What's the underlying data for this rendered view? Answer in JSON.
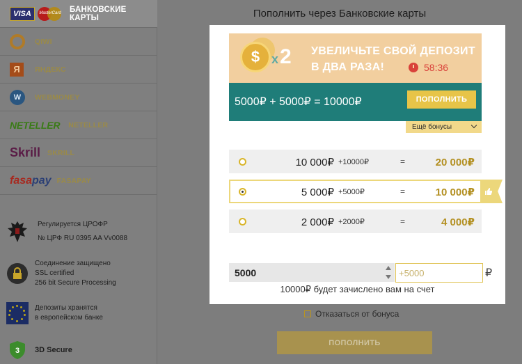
{
  "sidebar": {
    "items": [
      {
        "label": "БАНКОВСКИЕ КАРТЫ",
        "icon": "visa-mastercard-icon",
        "visa_text": "VISA",
        "mc_text": "MasterCard",
        "active": true
      },
      {
        "label": "QIWI",
        "icon": "qiwi-icon"
      },
      {
        "label": "ЯНДЕКС",
        "icon": "yandex-icon",
        "logo_text": "Я"
      },
      {
        "label": "WEBMONEY",
        "icon": "webmoney-icon",
        "logo_text": "W"
      },
      {
        "label": "NETELLER",
        "icon": "neteller-icon",
        "logo_text": "NETELLER"
      },
      {
        "label": "SKRILL",
        "icon": "skrill-icon",
        "logo_text": "Skrill"
      },
      {
        "label": "FASAPAY",
        "icon": "fasapay-icon",
        "logo_text_a": "fasa",
        "logo_text_b": "pay"
      }
    ],
    "info": {
      "regulation_line1": "Регулируется ЦРОФР",
      "regulation_line2": "№ ЦРФ RU 0395 AA Vv0088",
      "secure_line1": "Соединение защищено",
      "secure_line2": "SSL certified",
      "secure_line3": "256 bit Secure Processing",
      "deposit_line1": "Депозиты хранятся",
      "deposit_line2": "в европейском банке",
      "secure3d": "3D Secure"
    }
  },
  "main": {
    "title": "Пополнить через Банковские карты",
    "promo": {
      "coin_symbol": "$",
      "multiplier_x": "x",
      "multiplier_n": "2",
      "headline_line1": "УВЕЛИЧЬТЕ СВОЙ ДЕПОЗИТ",
      "headline_line2": "В ДВА РАЗА!",
      "timer": "58:36",
      "equation": "5000₽ + 5000₽ = 10000₽",
      "button_label": "ПОПОЛНИТЬ",
      "more_bonuses": "Ещё бонусы"
    },
    "options": [
      {
        "amount": "10 000₽",
        "bonus": "+10000₽",
        "eq": "=",
        "total": "20 000₽",
        "selected": false
      },
      {
        "amount": "5 000₽",
        "bonus": "+5000₽",
        "eq": "=",
        "total": "10 000₽",
        "selected": true
      },
      {
        "amount": "2 000₽",
        "bonus": "+2000₽",
        "eq": "=",
        "total": "4 000₽",
        "selected": false
      }
    ],
    "amount_value": "5000",
    "bonus_value": "+5000",
    "currency": "₽",
    "credited_text": "10000₽ будет зачислено вам на счет",
    "decline_label": "Отказаться от бонуса",
    "submit_label": "ПОПОЛНИТЬ"
  },
  "colors": {
    "accent_gold": "#e7c448",
    "promo_teal": "#1f7d79",
    "promo_peach": "#f2cf9f",
    "timer_red": "#d9413a"
  }
}
